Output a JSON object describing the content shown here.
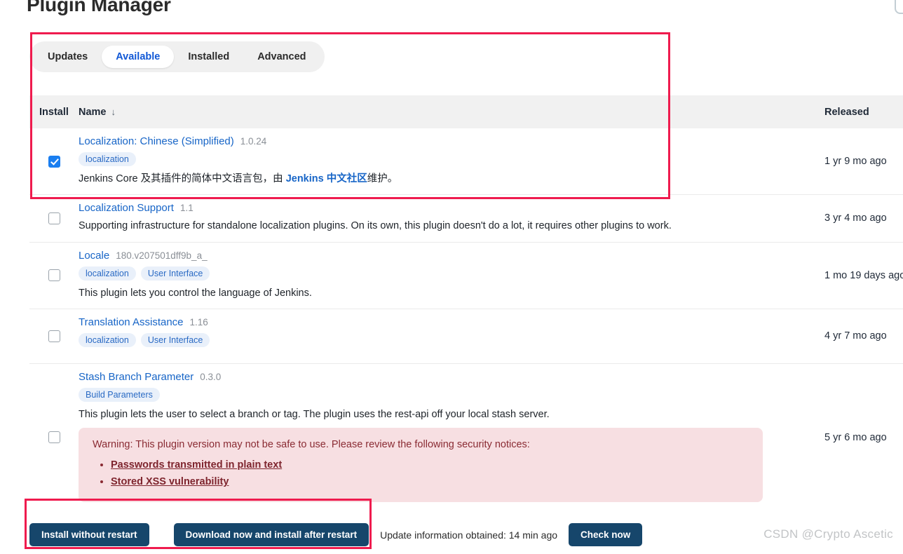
{
  "page": {
    "title": "Plugin Manager"
  },
  "tabs": [
    {
      "label": "Updates",
      "active": false
    },
    {
      "label": "Available",
      "active": true
    },
    {
      "label": "Installed",
      "active": false
    },
    {
      "label": "Advanced",
      "active": false
    }
  ],
  "table": {
    "headers": {
      "install": "Install",
      "name": "Name",
      "sort_indicator": "↓",
      "released": "Released"
    },
    "rows": [
      {
        "checked": true,
        "name": "Localization: Chinese (Simplified)",
        "version": "1.0.24",
        "labels": [
          "localization"
        ],
        "description_pre": "Jenkins Core 及其插件的简体中文语言包，由 ",
        "description_link": "Jenkins 中文社区",
        "description_post": "维护。",
        "released": "1 yr 9 mo ago"
      },
      {
        "checked": false,
        "name": "Localization Support",
        "version": "1.1",
        "labels": [],
        "description": "Supporting infrastructure for standalone localization plugins. On its own, this plugin doesn't do a lot, it requires other plugins to work.",
        "released": "3 yr 4 mo ago"
      },
      {
        "checked": false,
        "name": "Locale",
        "version": "180.v207501dff9b_a_",
        "labels": [
          "localization",
          "User Interface"
        ],
        "description": "This plugin lets you control the language of Jenkins.",
        "released": "1 mo 19 days ago"
      },
      {
        "checked": false,
        "name": "Translation Assistance",
        "version": "1.16",
        "labels": [
          "localization",
          "User Interface"
        ],
        "description": "",
        "released": "4 yr 7 mo ago"
      },
      {
        "checked": false,
        "name": "Stash Branch Parameter",
        "version": "0.3.0",
        "labels": [
          "Build Parameters"
        ],
        "description": "This plugin lets the user to select a branch or tag. The plugin uses the rest-api off your local stash server.",
        "released": "5 yr 6 mo ago",
        "warning": {
          "text": "Warning: This plugin version may not be safe to use. Please review the following security notices:",
          "notices": [
            "Passwords transmitted in plain text",
            "Stored XSS vulnerability"
          ]
        }
      }
    ]
  },
  "actions": {
    "install_without_restart": "Install without restart",
    "download_and_install_after_restart": "Download now and install after restart",
    "update_info": "Update information obtained: 14 min ago",
    "check_now": "Check now"
  },
  "watermark": "CSDN @Crypto Ascetic",
  "colors": {
    "accent_blue": "#1765c7",
    "tab_active_text": "#1158d6",
    "button_navy": "#16466b",
    "annotation_red": "#ef1b4e",
    "warning_bg": "#f7dfe2",
    "warning_text": "#8a2b33",
    "checkbox_checked": "#1a7ef0",
    "label_pill_bg": "#e9f0fa"
  }
}
